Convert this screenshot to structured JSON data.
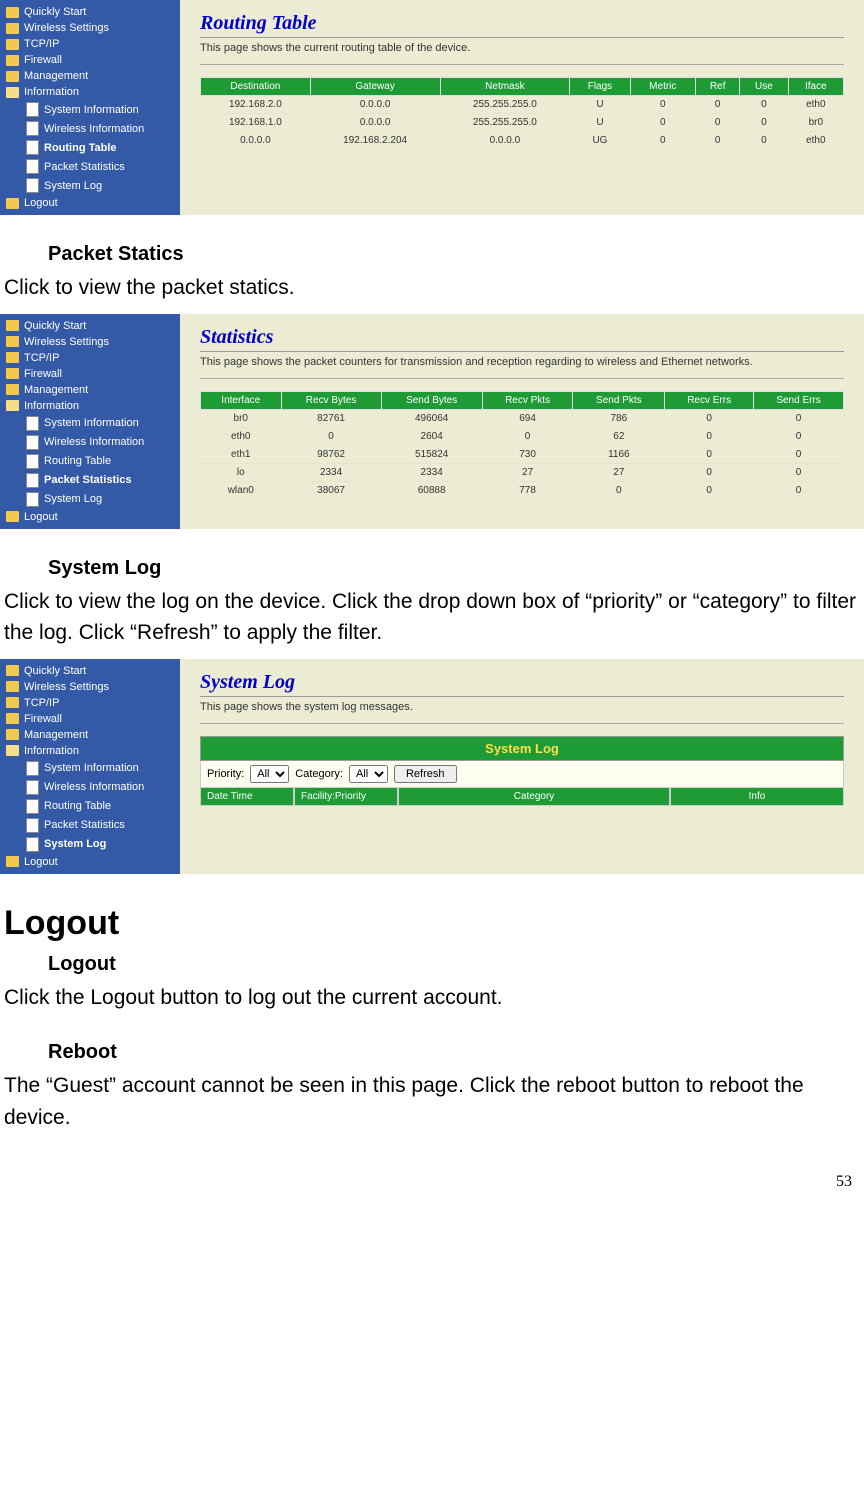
{
  "sidebar_common": {
    "items": [
      {
        "label": "Quickly Start",
        "icon": "folder"
      },
      {
        "label": "Wireless Settings",
        "icon": "folder"
      },
      {
        "label": "TCP/IP",
        "icon": "folder"
      },
      {
        "label": "Firewall",
        "icon": "folder"
      },
      {
        "label": "Management",
        "icon": "folder"
      },
      {
        "label": "Information",
        "icon": "folder-open"
      },
      {
        "label": "System Information",
        "icon": "file",
        "sub": true
      },
      {
        "label": "Wireless Information",
        "icon": "file",
        "sub": true
      },
      {
        "label": "Routing Table",
        "icon": "file",
        "sub": true
      },
      {
        "label": "Packet Statistics",
        "icon": "file",
        "sub": true
      },
      {
        "label": "System Log",
        "icon": "file",
        "sub": true
      },
      {
        "label": "Logout",
        "icon": "folder"
      }
    ]
  },
  "shot1": {
    "active": "Routing Table",
    "title": "Routing Table",
    "desc": "This page shows the current routing table of the device.",
    "cols": [
      "Destination",
      "Gateway",
      "Netmask",
      "Flags",
      "Metric",
      "Ref",
      "Use",
      "Iface"
    ],
    "rows": [
      [
        "192.168.2.0",
        "0.0.0.0",
        "255.255.255.0",
        "U",
        "0",
        "0",
        "0",
        "eth0"
      ],
      [
        "192.168.1.0",
        "0.0.0.0",
        "255.255.255.0",
        "U",
        "0",
        "0",
        "0",
        "br0"
      ],
      [
        "0.0.0.0",
        "192.168.2.204",
        "0.0.0.0",
        "UG",
        "0",
        "0",
        "0",
        "eth0"
      ]
    ]
  },
  "section1": {
    "heading": "Packet Statics",
    "body": "Click to view the packet statics."
  },
  "shot2": {
    "active": "Packet Statistics",
    "title": "Statistics",
    "desc": "This page shows the packet counters for transmission and reception regarding to wireless and Ethernet networks.",
    "cols": [
      "Interface",
      "Recv Bytes",
      "Send Bytes",
      "Recv Pkts",
      "Send Pkts",
      "Recv Errs",
      "Send Errs"
    ],
    "rows": [
      [
        "br0",
        "82761",
        "496064",
        "694",
        "786",
        "0",
        "0"
      ],
      [
        "eth0",
        "0",
        "2604",
        "0",
        "62",
        "0",
        "0"
      ],
      [
        "eth1",
        "98762",
        "515824",
        "730",
        "1166",
        "0",
        "0"
      ],
      [
        "lo",
        "2334",
        "2334",
        "27",
        "27",
        "0",
        "0"
      ],
      [
        "wlan0",
        "38067",
        "60888",
        "778",
        "0",
        "0",
        "0"
      ]
    ]
  },
  "section2": {
    "heading": "System Log",
    "body": "Click to view the log on the device. Click the drop down box of “priority” or “category” to filter the log. Click “Refresh” to apply the filter."
  },
  "shot3": {
    "active": "System Log",
    "title": "System Log",
    "desc": "This page shows the system log messages.",
    "banner": "System Log",
    "priority_label": "Priority:",
    "priority_value": "All",
    "category_label": "Category:",
    "category_value": "All",
    "refresh": "Refresh",
    "log_cols": [
      "Date Time",
      "Facility:Priority",
      "Category",
      "Info"
    ]
  },
  "logout": {
    "h1": "Logout",
    "sub1": "Logout",
    "body1": "Click the Logout button to log out the current account.",
    "sub2": "Reboot",
    "body2": "The “Guest” account cannot be seen in this page. Click the reboot button to reboot the device."
  },
  "page_number": "53"
}
